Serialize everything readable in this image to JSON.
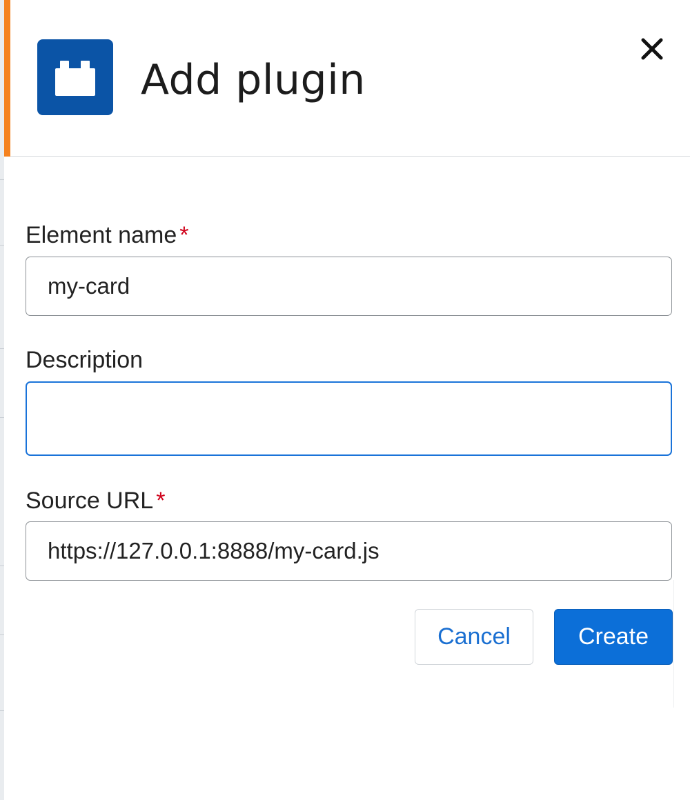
{
  "dialog": {
    "title": "Add plugin",
    "icon": "plugin-block-icon",
    "close_icon": "close-icon",
    "accent_color": "#f5821f",
    "icon_background": "#0b54a6"
  },
  "form": {
    "element_name": {
      "label": "Element name",
      "required_marker": "*",
      "value": "my-card"
    },
    "description": {
      "label": "Description",
      "value": ""
    },
    "source_url": {
      "label": "Source URL",
      "required_marker": "*",
      "value": "https://127.0.0.1:8888/my-card.js"
    }
  },
  "actions": {
    "cancel_label": "Cancel",
    "create_label": "Create",
    "primary_color": "#0c6fd8"
  }
}
